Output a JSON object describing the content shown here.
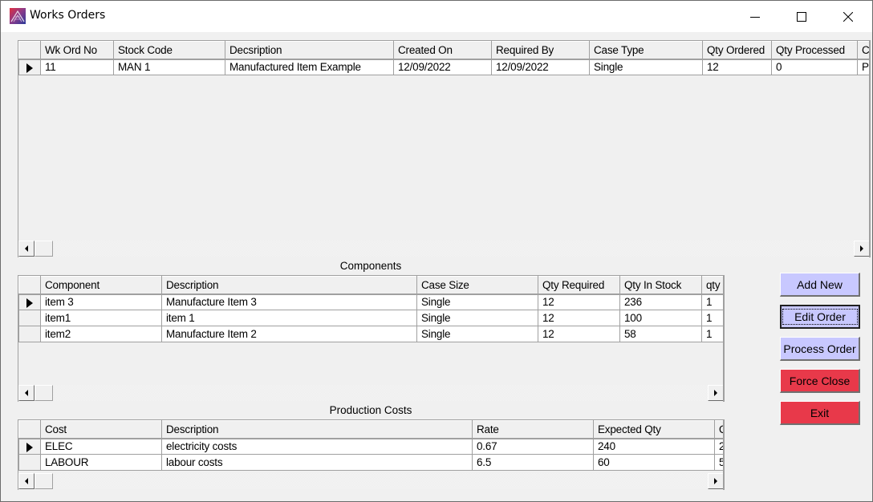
{
  "window": {
    "title": "Works Orders",
    "icon": "app-logo-icon",
    "controls": [
      "minimize-icon",
      "maximize-icon",
      "close-icon"
    ]
  },
  "orders_grid": {
    "columns": [
      "Wk Ord No",
      "Stock Code",
      "Decsription",
      "Created On",
      "Required By",
      "Case Type",
      "Qty Ordered",
      "Qty Processed",
      "C"
    ],
    "rows": [
      {
        "selected": true,
        "cells": [
          "11",
          "MAN 1",
          "Manufactured Item Example",
          "12/09/2022",
          "12/09/2022",
          "Single",
          "12",
          "0",
          "P"
        ]
      }
    ]
  },
  "components": {
    "caption": "Components",
    "columns": [
      "Component",
      "Description",
      "Case Size",
      "Qty Required",
      "Qty In Stock",
      "qty p"
    ],
    "rows": [
      {
        "selected": true,
        "cells": [
          "item 3",
          "Manufacture Item 3",
          "Single",
          "12",
          "236",
          "1"
        ]
      },
      {
        "selected": false,
        "cells": [
          "item1",
          "item 1",
          "Single",
          "12",
          "100",
          "1"
        ]
      },
      {
        "selected": false,
        "cells": [
          "item2",
          "Manufacture Item 2",
          "Single",
          "12",
          "58",
          "1"
        ]
      }
    ]
  },
  "production_costs": {
    "caption": "Production Costs",
    "columns": [
      "Cost",
      "Description",
      "Rate",
      "Expected Qty",
      "Q"
    ],
    "rows": [
      {
        "selected": true,
        "cells": [
          "ELEC",
          "electricity costs",
          "0.67",
          "240",
          "2"
        ]
      },
      {
        "selected": false,
        "cells": [
          "LABOUR",
          "labour costs",
          "6.5",
          "60",
          "5"
        ]
      }
    ]
  },
  "actions": {
    "add_new": "Add New",
    "edit_order": "Edit Order",
    "process_order": "Process Order",
    "force_close": "Force Close",
    "exit": "Exit"
  },
  "colors": {
    "action_blue": "#c8c8ff",
    "action_red": "#e8394a"
  }
}
